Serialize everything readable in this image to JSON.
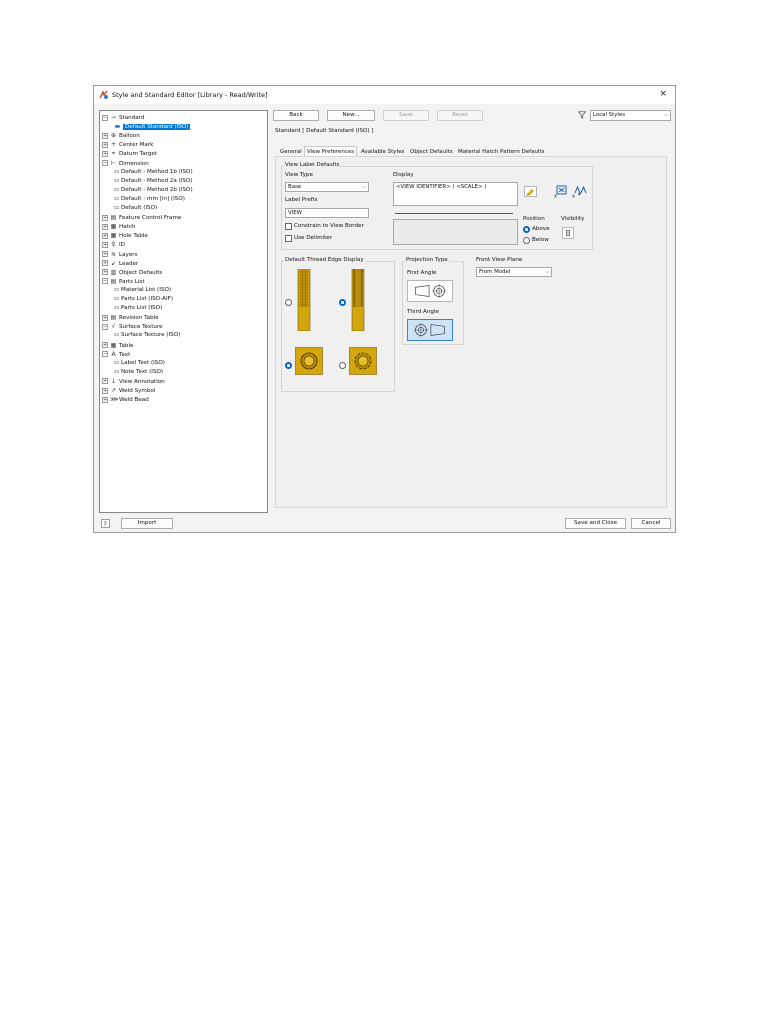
{
  "window": {
    "title": "Style and Standard Editor [Library - Read/Write]",
    "close_glyph": "×",
    "app_icon": "styles-editor-icon"
  },
  "tree": {
    "items": [
      {
        "label": "Standard",
        "icon": "standard-icon",
        "level": 0,
        "exp": "⊟"
      },
      {
        "label": "Default Standard (ISO)",
        "icon": "standard-item-icon",
        "level": 1,
        "selected": true
      },
      {
        "label": "Balloon",
        "icon": "balloon-icon",
        "level": 0,
        "exp": "⊞"
      },
      {
        "label": "Center Mark",
        "icon": "center-mark-icon",
        "level": 0,
        "exp": "⊞"
      },
      {
        "label": "Datum Target",
        "icon": "datum-target-icon",
        "level": 0,
        "exp": "⊞"
      },
      {
        "label": "Dimension",
        "icon": "dimension-icon",
        "level": 0,
        "exp": "⊟"
      },
      {
        "label": "Default - Method 1b (ISO)",
        "level": 1
      },
      {
        "label": "Default - Method 2a (ISO)",
        "level": 1
      },
      {
        "label": "Default - Method 2b (ISO)",
        "level": 1
      },
      {
        "label": "Default - mm [in] (ISO)",
        "level": 1
      },
      {
        "label": "Default (ISO)",
        "level": 1
      },
      {
        "label": "Feature Control Frame",
        "icon": "fcf-icon",
        "level": 0,
        "exp": "⊞"
      },
      {
        "label": "Hatch",
        "icon": "hatch-icon",
        "level": 0,
        "exp": "⊞"
      },
      {
        "label": "Hole Table",
        "icon": "hole-table-icon",
        "level": 0,
        "exp": "⊞"
      },
      {
        "label": "ID",
        "icon": "id-icon",
        "level": 0,
        "exp": "⊞"
      },
      {
        "label": "Layers",
        "icon": "layers-icon",
        "level": 0,
        "exp": "⊞"
      },
      {
        "label": "Leader",
        "icon": "leader-icon",
        "level": 0,
        "exp": "⊞"
      },
      {
        "label": "Object Defaults",
        "icon": "object-defaults-icon",
        "level": 0,
        "exp": "⊞"
      },
      {
        "label": "Parts List",
        "icon": "parts-list-icon",
        "level": 0,
        "exp": "⊟"
      },
      {
        "label": "Material List (ISO)",
        "level": 1
      },
      {
        "label": "Parts List (ISO-AIF)",
        "level": 1
      },
      {
        "label": "Parts List (ISO)",
        "level": 1
      },
      {
        "label": "Revision Table",
        "icon": "revision-table-icon",
        "level": 0,
        "exp": "⊞"
      },
      {
        "label": "Surface Texture",
        "icon": "surface-texture-icon",
        "level": 0,
        "exp": "⊟"
      },
      {
        "label": "Surface Texture (ISO)",
        "level": 1
      },
      {
        "label": "Table",
        "icon": "table-icon",
        "level": 0,
        "exp": "⊞"
      },
      {
        "label": "Text",
        "icon": "text-icon",
        "level": 0,
        "exp": "⊟"
      },
      {
        "label": "Label Text (ISO)",
        "level": 1
      },
      {
        "label": "Note Text (ISO)",
        "level": 1
      },
      {
        "label": "View Annotation",
        "icon": "view-annotation-icon",
        "level": 0,
        "exp": "⊞"
      },
      {
        "label": "Weld Symbol",
        "icon": "weld-symbol-icon",
        "level": 0,
        "exp": "⊞"
      },
      {
        "label": "Weld Bead",
        "icon": "weld-bead-icon",
        "level": 0,
        "exp": "⊞"
      }
    ]
  },
  "toolbar": {
    "back": "Back",
    "new": "New...",
    "save": "Save",
    "reset": "Reset",
    "filter_icon": "filter-icon",
    "filter_value": "Local Styles",
    "arrow": "⌵"
  },
  "breadcrumb": "Standard [ Default Standard (ISO) ]",
  "tabs": [
    "General",
    "View Preferences",
    "Available Styles",
    "Object Defaults",
    "Material Hatch Pattern Defaults"
  ],
  "active_tab": 1,
  "view_label": {
    "group_title": "View Label Defaults",
    "view_type_label": "View Type",
    "view_type_value": "Base",
    "label_prefix_label": "Label Prefix",
    "label_prefix_value": "VIEW",
    "constrain_label": "Constrain to View Border",
    "delimiter_label": "Use Delimiter",
    "display_label": "Display",
    "display_value": "<VIEW IDENTIFIER> ( <SCALE> )",
    "position_label": "Position",
    "above": "Above",
    "below": "Below",
    "visibility_label": "Visibility"
  },
  "thread": {
    "group_title": "Default Thread Edge Display"
  },
  "projection": {
    "group_title": "Projection Type",
    "first": "First Angle",
    "third": "Third Angle"
  },
  "front_plane": {
    "label": "Front View Plane",
    "value": "From Model"
  },
  "footer": {
    "help_icon": "help-icon",
    "import": "Import",
    "save_close": "Save and Close",
    "cancel": "Cancel"
  },
  "colors": {
    "selection": "#0078d7",
    "radio_on": "#0067c0",
    "thread_gold": "#d4a60e"
  }
}
